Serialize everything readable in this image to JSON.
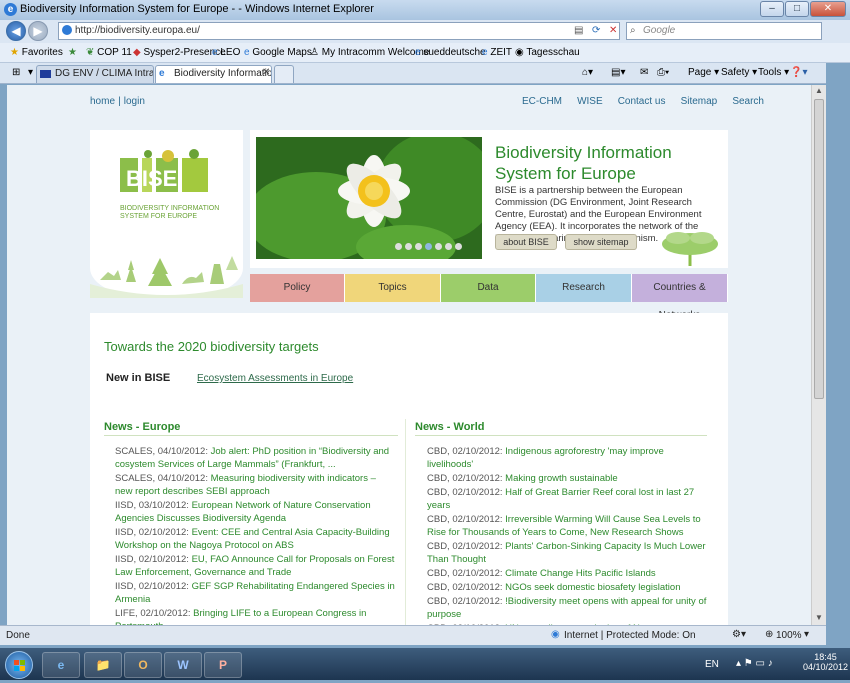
{
  "window": {
    "title": "Biodiversity Information System for Europe - - Windows Internet Explorer",
    "min_label": "–",
    "max_label": "□",
    "close_label": "✕"
  },
  "address": {
    "url": "http://biodiversity.europa.eu/",
    "search_placeholder": "Google"
  },
  "favorites": {
    "label": "Favorites",
    "items": [
      "COP 11",
      "Sysper2-Presence",
      "LEO",
      "Google Maps",
      "My Intracomm Welcome",
      "sueddeutsche",
      "ZEIT",
      "Tagesschau"
    ]
  },
  "tabs": [
    {
      "label": "DG ENV / CLIMA Intranet -..."
    },
    {
      "label": "Biodiversity Informatio..."
    }
  ],
  "toolbar": {
    "page": "Page",
    "safety": "Safety",
    "tools": "Tools"
  },
  "site": {
    "home": "home",
    "separator": "|",
    "login": "login",
    "toplinks": [
      "EC-CHM",
      "WISE",
      "Contact us",
      "Sitemap",
      "Search"
    ],
    "logo_text_line1": "BIODIVERSITY INFORMATION",
    "logo_text_line2": "SYSTEM FOR EUROPE",
    "hero_title": "Biodiversity Information System for Europe",
    "hero_text": "BISE is a partnership between the European Commission (DG Environment, Joint Research Centre, Eurostat) and the European Environment Agency (EEA). It incorporates the network of the European Clearing House Mechanism.",
    "about_btn": "about BISE",
    "sitemap_btn": "show sitemap",
    "slides": 7,
    "active_slide": 3,
    "nav": [
      {
        "label": "Policy",
        "color": "#e4a19d"
      },
      {
        "label": "Topics",
        "color": "#f0d67a"
      },
      {
        "label": "Data",
        "color": "#9ccd6a"
      },
      {
        "label": "Research",
        "color": "#a9d0e6"
      },
      {
        "label": "Countries & Networks",
        "color": "#c4b0dc"
      }
    ],
    "headline": "Towards the 2020 biodiversity targets",
    "new_label": "New in BISE",
    "new_link": "Ecosystem Assessments in Europe",
    "news_europe_title": "News - Europe",
    "news_world_title": "News - World",
    "news_europe": [
      {
        "src": "SCALES, 04/10/2012:",
        "text": "Job alert: PhD position in “Biodiversity and cosystem Services of Large Mammals” (Frankfurt, ..."
      },
      {
        "src": "SCALES, 04/10/2012:",
        "text": "Measuring biodiversity with indicators – new report describes SEBI approach"
      },
      {
        "src": "IISD, 03/10/2012:",
        "text": "European Network of Nature Conservation Agencies Discusses Biodiversity Agenda"
      },
      {
        "src": "IISD, 02/10/2012:",
        "text": "Event: CEE and Central Asia Capacity-Building Workshop on the Nagoya Protocol on ABS"
      },
      {
        "src": "IISD, 02/10/2012:",
        "text": "EU, FAO Announce Call for Proposals on Forest Law Enforcement, Governance and Trade"
      },
      {
        "src": "IISD, 02/10/2012:",
        "text": "GEF SGP Rehabilitating Endangered Species in Armenia"
      },
      {
        "src": "LIFE, 02/10/2012:",
        "text": "Bringing LIFE to a European Congress in Portsmouth"
      }
    ],
    "news_world": [
      {
        "src": "CBD, 02/10/2012:",
        "text": "Indigenous agroforestry 'may improve livelihoods'"
      },
      {
        "src": "CBD, 02/10/2012:",
        "text": "Making growth sustainable"
      },
      {
        "src": "CBD, 02/10/2012:",
        "text": "Half of Great Barrier Reef coral lost in last 27 years"
      },
      {
        "src": "CBD, 02/10/2012:",
        "text": "Irreversible Warming Will Cause Sea Levels to Rise for Thousands of Years to Come, New Research Shows"
      },
      {
        "src": "CBD, 02/10/2012:",
        "text": "Plants' Carbon-Sinking Capacity Is Much Lower Than Thought"
      },
      {
        "src": "CBD, 02/10/2012:",
        "text": "Climate Change Hits Pacific Islands"
      },
      {
        "src": "CBD, 02/10/2012:",
        "text": "NGOs seek domestic biosafety legislation"
      },
      {
        "src": "CBD, 02/10/2012:",
        "text": "!Biodiversity meet opens with appeal for unity of purpose"
      },
      {
        "src": "CBD, 02/10/2012:",
        "text": "UN meet discusses signing of Nagoya Supplementary Protocol"
      }
    ]
  },
  "status": {
    "left": "Done",
    "zone": "Internet | Protected Mode: On",
    "zoom": "100%"
  },
  "taskbar": {
    "lang": "EN",
    "time": "18:45",
    "date": "04/10/2012",
    "apps": [
      "e",
      "📁",
      "O",
      "W",
      "P"
    ]
  }
}
